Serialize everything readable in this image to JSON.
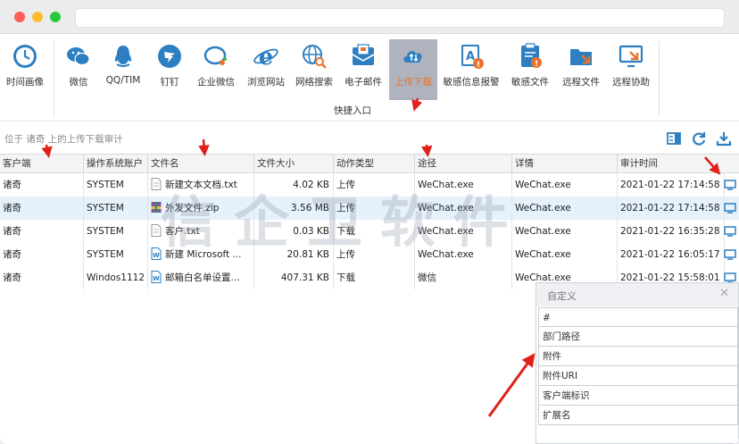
{
  "toolbar": {
    "items": [
      {
        "label": "时间画像",
        "icon": "clock-icon"
      },
      {
        "label": "微信",
        "icon": "wechat-icon"
      },
      {
        "label": "QQ/TIM",
        "icon": "qq-icon"
      },
      {
        "label": "钉钉",
        "icon": "dingtalk-icon"
      },
      {
        "label": "企业微信",
        "icon": "wecom-icon"
      },
      {
        "label": "浏览网站",
        "icon": "ie-icon"
      },
      {
        "label": "网络搜索",
        "icon": "web-search-icon"
      },
      {
        "label": "电子邮件",
        "icon": "mail-icon"
      },
      {
        "label": "上传下载",
        "icon": "cloud-transfer-icon"
      },
      {
        "label": "敏感信息报警",
        "icon": "sensitive-alert-icon"
      },
      {
        "label": "敏感文件",
        "icon": "sensitive-file-icon"
      },
      {
        "label": "远程文件",
        "icon": "remote-file-icon"
      },
      {
        "label": "远程协助",
        "icon": "remote-assist-icon"
      }
    ],
    "group_label": "快捷入口",
    "active_color": "#e8742b"
  },
  "path": {
    "text": "位于 诸奇 上的上传下载审计"
  },
  "table": {
    "columns": [
      "客户端",
      "操作系统账户",
      "文件名",
      "文件大小",
      "动作类型",
      "途径",
      "详情",
      "审计时间"
    ],
    "rows": [
      {
        "client": "诸奇",
        "account": "SYSTEM",
        "file": "新建文本文档.txt",
        "ftype": "txt",
        "size": "4.02 KB",
        "action": "上传",
        "via": "WeChat.exe",
        "detail": "WeChat.exe",
        "time": "2021-01-22 17:14:58"
      },
      {
        "client": "诸奇",
        "account": "SYSTEM",
        "file": "外发文件.zip",
        "ftype": "zip",
        "size": "3.56 MB",
        "action": "上传",
        "via": "WeChat.exe",
        "detail": "WeChat.exe",
        "time": "2021-01-22 17:14:58"
      },
      {
        "client": "诸奇",
        "account": "SYSTEM",
        "file": "客户.txt",
        "ftype": "txt",
        "size": "0.03 KB",
        "action": "下载",
        "via": "WeChat.exe",
        "detail": "WeChat.exe",
        "time": "2021-01-22 16:35:28"
      },
      {
        "client": "诸奇",
        "account": "SYSTEM",
        "file": "新建 Microsoft ...",
        "ftype": "doc",
        "size": "20.81 KB",
        "action": "上传",
        "via": "WeChat.exe",
        "detail": "WeChat.exe",
        "time": "2021-01-22 16:05:17"
      },
      {
        "client": "诸奇",
        "account": "Windos1112",
        "file": "邮箱白名单设置...",
        "ftype": "doc",
        "size": "407.31 KB",
        "action": "下载",
        "via": "微信",
        "detail": "WeChat.exe",
        "time": "2021-01-22 15:58:01"
      }
    ]
  },
  "watermark": "信企卫软件",
  "panel": {
    "title": "自定义",
    "close": "✕",
    "items": [
      "#",
      "部门路径",
      "附件",
      "附件URI",
      "客户端标识",
      "扩展名"
    ]
  }
}
